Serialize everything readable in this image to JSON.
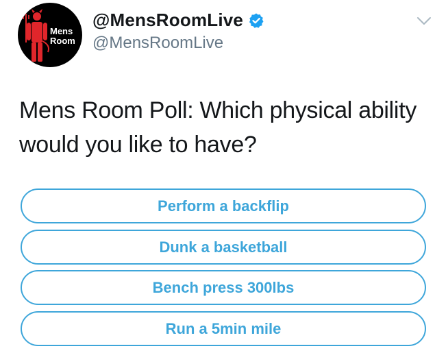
{
  "author": {
    "display_name": "@MensRoomLive",
    "handle": "@MensRoomLive",
    "avatar_text_line1": "Mens",
    "avatar_text_line2": "Room",
    "verified_icon": "verified-badge-icon"
  },
  "tweet": {
    "text": "Mens Room Poll: Which physical ability would you like to have?"
  },
  "poll": {
    "options": [
      {
        "label": "Perform a backflip"
      },
      {
        "label": "Dunk a basketball"
      },
      {
        "label": "Bench press 300lbs"
      },
      {
        "label": "Run a 5min mile"
      }
    ]
  },
  "colors": {
    "accent": "#3ea6da",
    "text": "#14171a",
    "secondary_text": "#657786",
    "avatar_red": "#e0262b"
  },
  "icons": {
    "menu": "chevron-down-icon"
  }
}
